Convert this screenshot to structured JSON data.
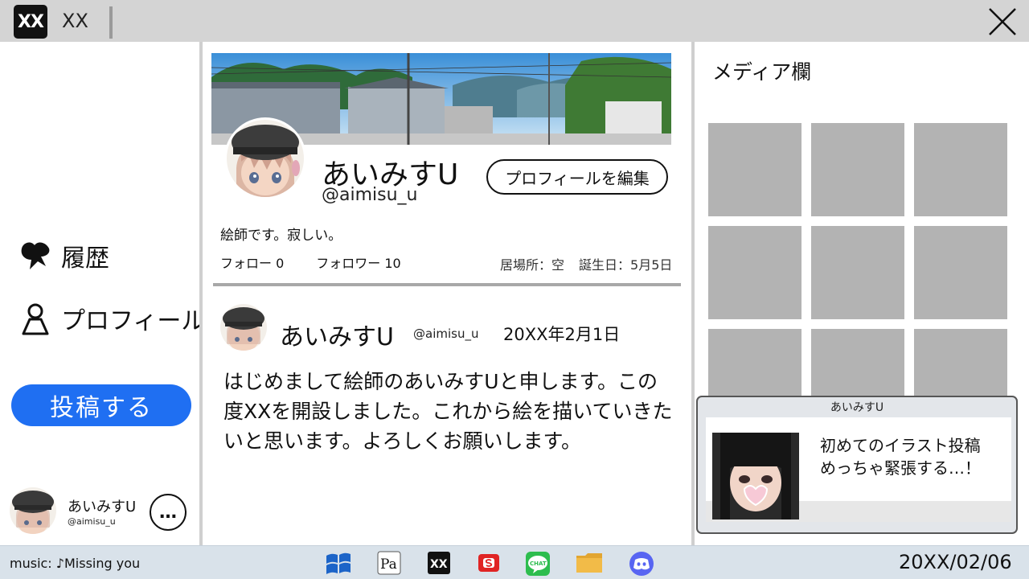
{
  "window": {
    "logo": "XX",
    "title": "XX",
    "close_icon": "close-icon"
  },
  "sidebar": {
    "items": [
      {
        "label": "履歴",
        "icon": "history-bird-icon"
      },
      {
        "label": "プロフィール",
        "icon": "person-icon"
      }
    ],
    "post_button": "投稿する",
    "account": {
      "name": "あいみすU",
      "handle": "@aimisu_u",
      "more": "…"
    }
  },
  "profile": {
    "display_name": "あいみすU",
    "username": "@aimisu_u",
    "edit_button": "プロフィールを編集",
    "bio": "絵師です。寂しい。",
    "following": "フォロー 0",
    "followers": "フォロワー 10",
    "location": "居場所：空",
    "birthday": "誕生日：5月5日"
  },
  "post": {
    "name": "あいみすU",
    "handle": "@aimisu_u",
    "date": "20XX年2月1日",
    "body": "はじめまして絵師のあいみすUと申します。この度XXを開設しました。これから絵を描いていきたいと思います。よろしくお願いします。"
  },
  "media": {
    "title": "メディア欄",
    "tile_count": 9,
    "tile_color": "#b3b3b3"
  },
  "notification": {
    "sender": "あいみすU",
    "line1": "初めてのイラスト投稿",
    "line2": "めっちゃ緊張する…！"
  },
  "taskbar": {
    "music": "music: ♪Missing you",
    "apps": [
      "windows-icon",
      "pa-editor-icon",
      "xx-app-icon",
      "s-app-icon",
      "chat-icon",
      "folder-icon",
      "discord-icon"
    ],
    "xx_label": "XX",
    "chat_label": "CHAT",
    "pa_label": "Pa",
    "clock": "20XX/02/06"
  },
  "colors": {
    "accent": "#1f6ff2",
    "titlebar": "#d4d4d4",
    "taskbar": "#d9e2ea"
  }
}
